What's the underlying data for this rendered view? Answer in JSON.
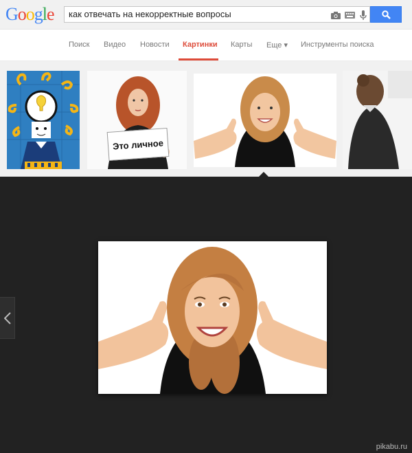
{
  "logo": {
    "letters": [
      {
        "char": "G",
        "color": "#4285f4"
      },
      {
        "char": "o",
        "color": "#ea4335"
      },
      {
        "char": "o",
        "color": "#fbbc05"
      },
      {
        "char": "g",
        "color": "#4285f4"
      },
      {
        "char": "l",
        "color": "#34a853"
      },
      {
        "char": "e",
        "color": "#ea4335"
      }
    ]
  },
  "search": {
    "query": "как отвечать на некорректные вопросы",
    "icons": [
      "camera-icon",
      "keyboard-icon",
      "microphone-icon"
    ],
    "button_icon": "magnifier-icon",
    "button_color": "#4285f4"
  },
  "tabs": [
    {
      "label": "Поиск",
      "active": false
    },
    {
      "label": "Видео",
      "active": false
    },
    {
      "label": "Новости",
      "active": false
    },
    {
      "label": "Картинки",
      "active": true
    },
    {
      "label": "Карты",
      "active": false
    },
    {
      "label": "Еще ▾",
      "active": false
    },
    {
      "label": "Инструменты поиска",
      "active": false
    }
  ],
  "accent_color": "#dd4b39",
  "thumbnails": [
    {
      "subject": "illustration-lightbulb-head"
    },
    {
      "subject": "woman-holding-sign",
      "sign_text": "Это личное"
    },
    {
      "subject": "woman-thumbs-up",
      "selected": true
    },
    {
      "subject": "woman-from-behind"
    }
  ],
  "viewer": {
    "background": "#222222",
    "image_subject": "woman-thumbs-up",
    "prev_icon": "chevron-left-icon"
  },
  "watermark": "pikabu.ru"
}
